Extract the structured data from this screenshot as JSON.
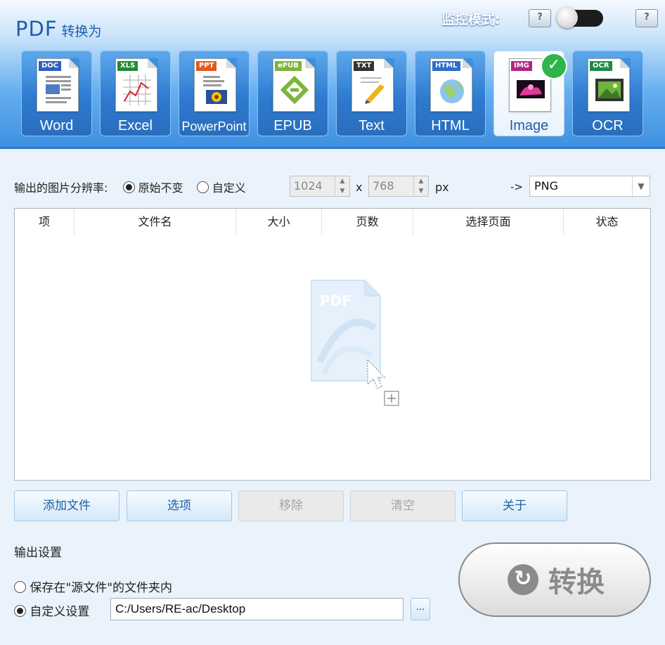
{
  "header": {
    "title_main": "PDF",
    "title_sub": "转换为",
    "monitor_label": "监控模式:",
    "help_label": "?"
  },
  "formats": [
    {
      "label": "Word",
      "tag": "DOC",
      "color": "#2f5fb8"
    },
    {
      "label": "Excel",
      "tag": "XLS",
      "color": "#238a36"
    },
    {
      "label": "PowerPoint",
      "tag": "PPT",
      "color": "#e05a1d"
    },
    {
      "label": "EPUB",
      "tag": "ePUB",
      "color": "#7db43a"
    },
    {
      "label": "Text",
      "tag": "TXT",
      "color": "#333333"
    },
    {
      "label": "HTML",
      "tag": "HTML",
      "color": "#2b6ec8"
    },
    {
      "label": "Image",
      "tag": "IMG",
      "color": "#b0267f",
      "selected": true
    },
    {
      "label": "OCR",
      "tag": "OCR",
      "color": "#1f8a4a"
    }
  ],
  "resolution": {
    "label": "输出的图片分辨率:",
    "option_original": "原始不变",
    "option_custom": "自定义",
    "width": "1024",
    "x": "x",
    "height": "768",
    "unit": "px",
    "arrow": "->",
    "format_value": "PNG"
  },
  "table": {
    "columns": [
      "项",
      "文件名",
      "大小",
      "页数",
      "选择页面",
      "状态"
    ],
    "drop_hint_text": "PDF"
  },
  "buttons": {
    "add": "添加文件",
    "options": "选项",
    "remove": "移除",
    "clear": "清空",
    "about": "关于"
  },
  "output": {
    "label": "输出设置",
    "save_source": "保存在\"源文件\"的文件夹内",
    "custom": "自定义设置",
    "path": "C:/Users/RE-ac/Desktop",
    "browse": "..."
  },
  "convert": {
    "label": "转换"
  }
}
